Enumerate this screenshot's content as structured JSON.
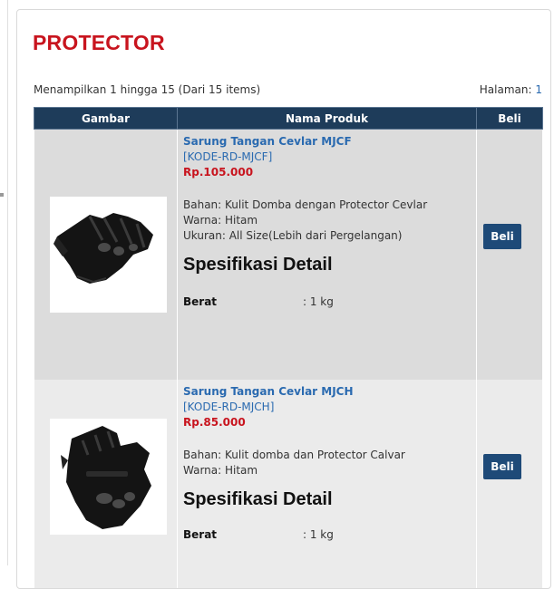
{
  "page_title": "PROTECTOR",
  "listing": {
    "showing_text": "Menampilkan 1 hingga 15 (Dari 15 items)",
    "page_label": "Halaman:",
    "page_number": "1"
  },
  "table": {
    "headers": [
      "Gambar",
      "Nama Produk",
      "Beli"
    ]
  },
  "products": [
    {
      "name": "Sarung Tangan Cevlar MJCF",
      "code": "[KODE-RD-MJCF]",
      "price": "Rp.105.000",
      "desc": [
        "Bahan: Kulit Domba dengan Protector Cevlar",
        "Warna: Hitam",
        "Ukuran: All Size(Lebih dari Pergelangan)"
      ],
      "spec_title": "Spesifikasi Detail",
      "weight_label": "Berat",
      "weight_value": ": 1 kg",
      "buy_label": "Beli",
      "image_icon": "glove-icon"
    },
    {
      "name": "Sarung Tangan Cevlar MJCH",
      "code": "[KODE-RD-MJCH]",
      "price": "Rp.85.000",
      "desc": [
        "Bahan: Kulit domba dan Protector Calvar",
        "Warna: Hitam"
      ],
      "spec_title": "Spesifikasi Detail",
      "weight_label": "Berat",
      "weight_value": ": 1 kg",
      "buy_label": "Beli",
      "image_icon": "fingerless-glove-icon"
    }
  ],
  "colors": {
    "title_red": "#c8141e",
    "link_blue": "#2a6ab0",
    "header_navy": "#1e3c5a",
    "button_navy": "#1e4a78"
  }
}
